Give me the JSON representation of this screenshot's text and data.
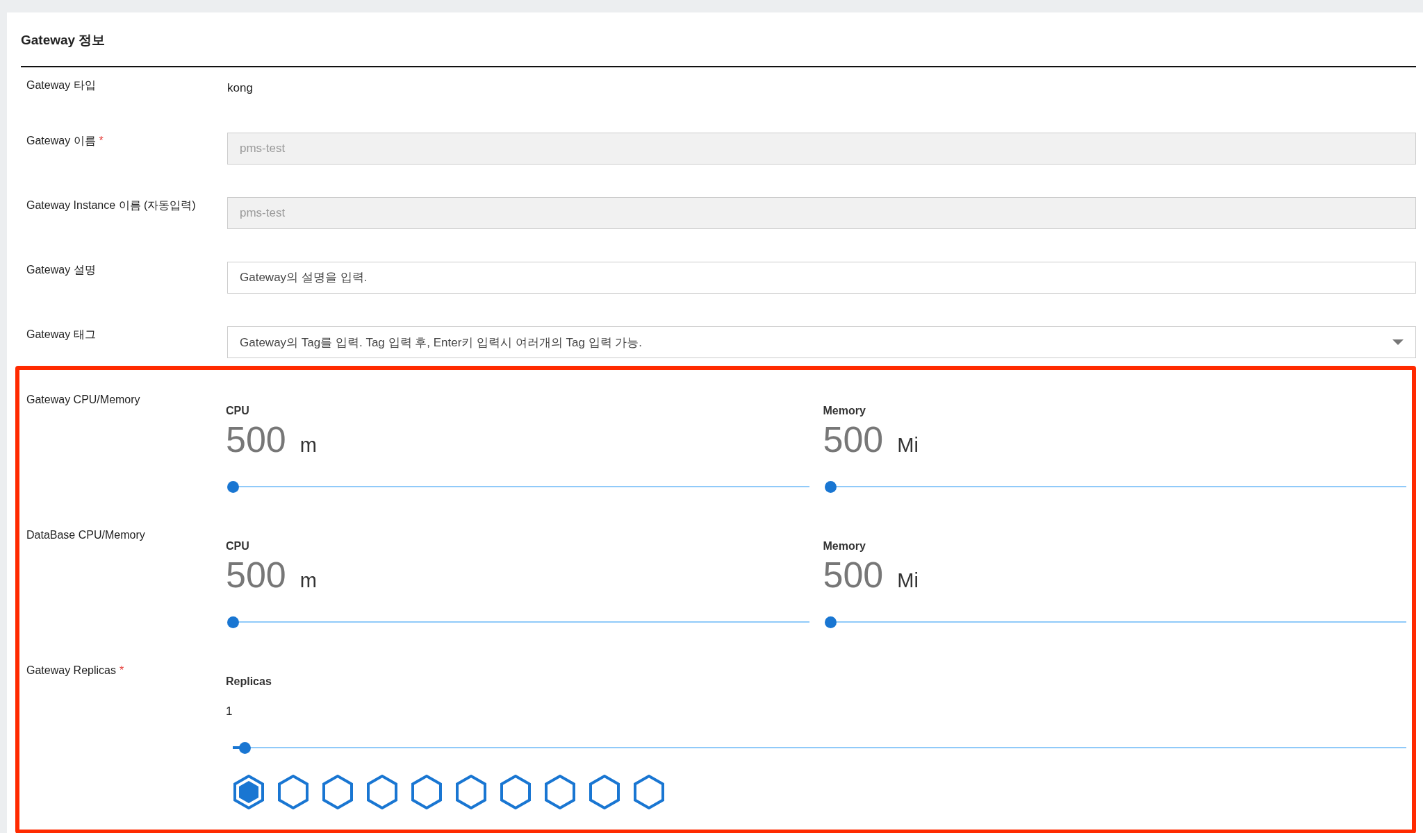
{
  "panel": {
    "title": "Gateway 정보"
  },
  "rows": [
    {
      "kind": "text",
      "label": "Gateway 타입",
      "value": "kong"
    },
    {
      "kind": "input",
      "label": "Gateway 이름",
      "required_mark": "*",
      "value": "pms-test",
      "disabled": true
    },
    {
      "kind": "input",
      "label": "Gateway Instance 이름 (자동입력)",
      "value": "pms-test",
      "disabled": true
    },
    {
      "kind": "input",
      "label": "Gateway 설명",
      "placeholder": "Gateway의 설명을 입력.",
      "disabled": false
    },
    {
      "kind": "select",
      "label": "Gateway 태그",
      "placeholder": "Gateway의 Tag를 입력. Tag 입력 후, Enter키 입력시 여러개의 Tag 입력 가능."
    }
  ],
  "highlight": {
    "resources": [
      {
        "label": "Gateway CPU/Memory",
        "meters": [
          {
            "name": "CPU",
            "value": "500",
            "unit": "m",
            "level": 0
          },
          {
            "name": "Memory",
            "value": "500",
            "unit": "Mi",
            "level": 0
          }
        ]
      },
      {
        "label": "DataBase CPU/Memory",
        "meters": [
          {
            "name": "CPU",
            "value": "500",
            "unit": "m",
            "level": 0
          },
          {
            "name": "Memory",
            "value": "500",
            "unit": "Mi",
            "level": 0
          }
        ]
      }
    ],
    "replicas": {
      "label": "Gateway Replicas",
      "required_mark": "*",
      "name": "Replicas",
      "value": "1",
      "level": 0.01,
      "pods": [
        {
          "selected": true
        },
        {
          "selected": false
        },
        {
          "selected": false
        },
        {
          "selected": false
        },
        {
          "selected": false
        },
        {
          "selected": false
        },
        {
          "selected": false
        },
        {
          "selected": false
        },
        {
          "selected": false
        },
        {
          "selected": false
        }
      ]
    }
  }
}
